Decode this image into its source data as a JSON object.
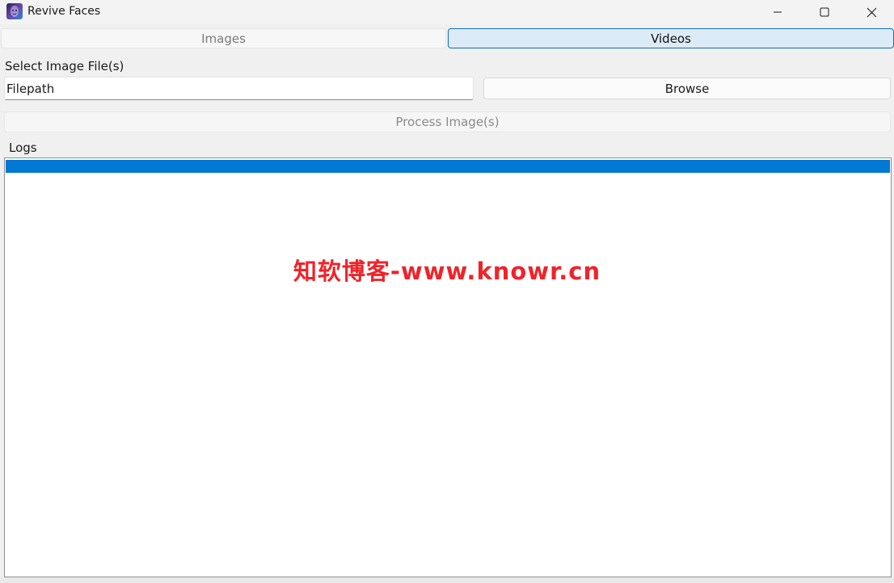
{
  "window": {
    "title": "Revive Faces",
    "icon": "app-face-icon",
    "controls": [
      "minimize-icon",
      "maximize-icon",
      "close-icon"
    ]
  },
  "tabs": [
    {
      "label": "Images",
      "selected": false
    },
    {
      "label": "Videos",
      "selected": true
    }
  ],
  "select_label": "Select Image File(s)",
  "filepath": {
    "value": "",
    "placeholder": "Filepath"
  },
  "browse_label": "Browse",
  "process_label": "Process Image(s)",
  "logs_label": "Logs",
  "watermark": "知软博客-www.knowr.cn",
  "colors": {
    "accent": "#0078d4",
    "selected_tab_bg": "#dcebf8",
    "watermark": "#f0232a"
  }
}
